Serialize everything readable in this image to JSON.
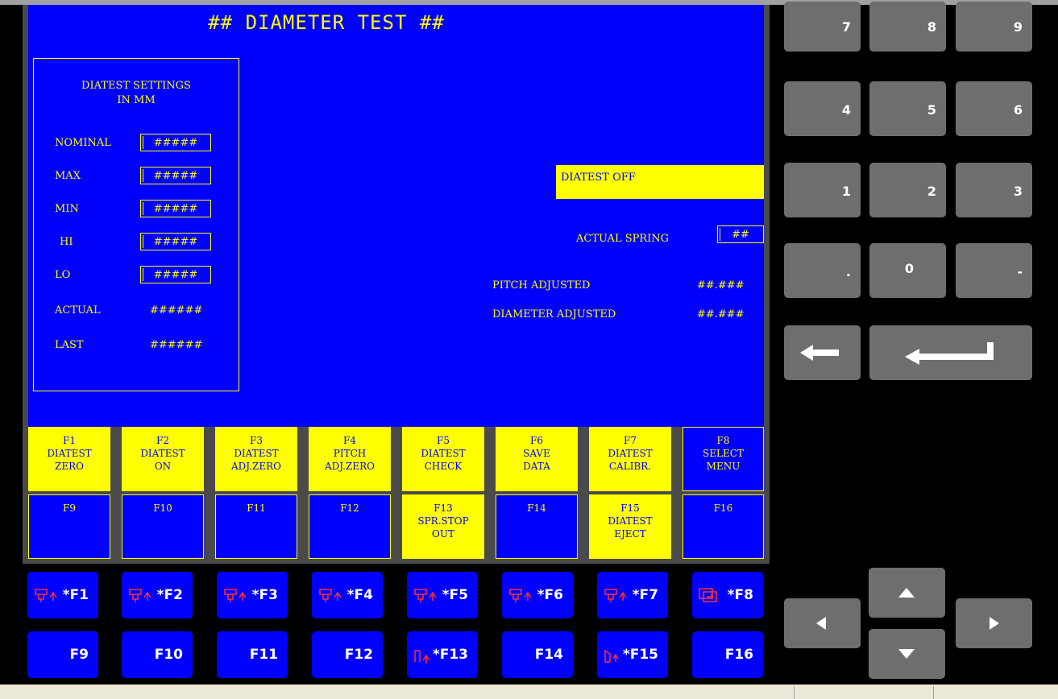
{
  "title": "## DIAMETER TEST ##",
  "settings": {
    "header": "DIATEST SETTINGS",
    "sub": "IN MM",
    "rows": [
      {
        "label": "NOMINAL",
        "value": "#####"
      },
      {
        "label": "MAX",
        "value": "#####"
      },
      {
        "label": "MIN",
        "value": "#####"
      },
      {
        "label": "HI",
        "value": "#####"
      },
      {
        "label": "LO",
        "value": "#####"
      }
    ],
    "actual_label": "ACTUAL",
    "actual_value": "######",
    "last_label": "LAST",
    "last_value": "######"
  },
  "status_text": "DIATEST OFF",
  "actual_spring": {
    "label": "ACTUAL SPRING",
    "value": "##"
  },
  "pitch": {
    "label": "PITCH ADJUSTED",
    "value": "##.###"
  },
  "diameter": {
    "label": "DIAMETER ADJUSTED",
    "value": "##.###"
  },
  "fkeys": [
    {
      "label": "F1\nDIATEST\nZERO",
      "style": "yellow"
    },
    {
      "label": "F2\nDIATEST\nON",
      "style": "yellow"
    },
    {
      "label": "F3\nDIATEST\nADJ.ZERO",
      "style": "yellow"
    },
    {
      "label": "F4\nPITCH\nADJ.ZERO",
      "style": "yellow"
    },
    {
      "label": "F5\nDIATEST\nCHECK",
      "style": "yellow"
    },
    {
      "label": "F6\nSAVE\nDATA",
      "style": "yellow"
    },
    {
      "label": "F7\nDIATEST\nCALIBR.",
      "style": "yellow"
    },
    {
      "label": "F8\nSELECT\nMENU",
      "style": "blue"
    },
    {
      "label": "F9",
      "style": "blue"
    },
    {
      "label": "F10",
      "style": "blue"
    },
    {
      "label": "F11",
      "style": "blue"
    },
    {
      "label": "F12",
      "style": "blue"
    },
    {
      "label": "F13\nSPR.STOP\nOUT",
      "style": "yellow"
    },
    {
      "label": "F14",
      "style": "blue"
    },
    {
      "label": "F15\nDIATEST\nEJECT",
      "style": "yellow"
    },
    {
      "label": "F16",
      "style": "blue"
    }
  ],
  "hw_buttons_top": [
    "*F1",
    "*F2",
    "*F3",
    "*F4",
    "*F5",
    "*F6",
    "*F7",
    "*F8"
  ],
  "hw_buttons_bottom": [
    "F9",
    "F10",
    "F11",
    "F12",
    "*F13",
    "F14",
    "*F15",
    "F16"
  ],
  "keypad": [
    "7",
    "8",
    "9",
    "4",
    "5",
    "6",
    "1",
    "2",
    "3",
    ".",
    "0",
    "-"
  ],
  "colors": {
    "screen": "#0000ff",
    "accent": "#ffff00",
    "keypad": "#6e6e6e"
  }
}
